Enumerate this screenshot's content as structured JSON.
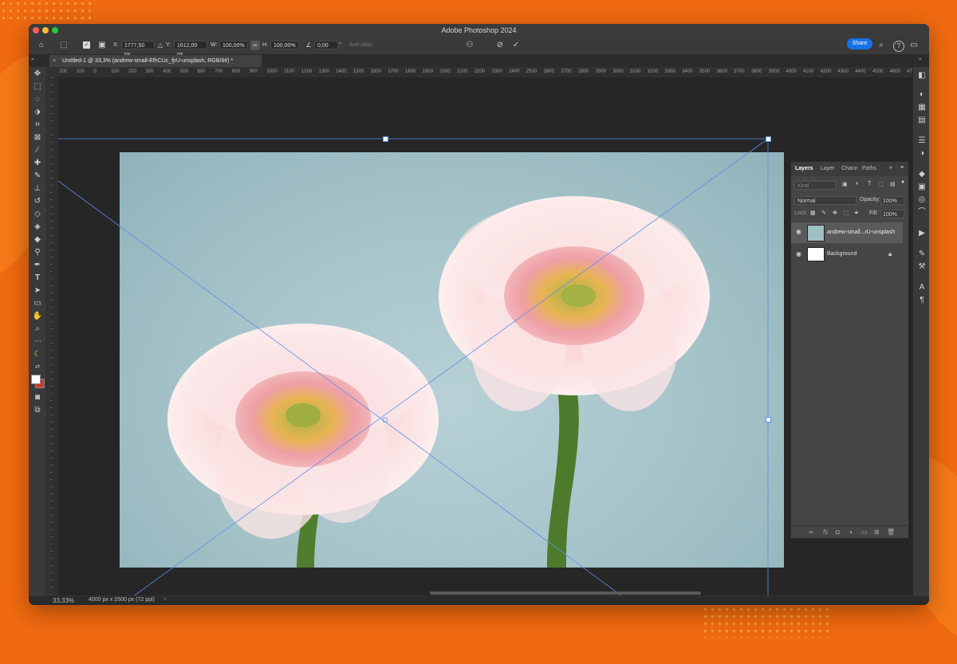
{
  "app": {
    "title": "Adobe Photoshop 2024"
  },
  "options_bar": {
    "x_label": "X:",
    "x_value": "1777,50 px",
    "y_label": "Y:",
    "y_value": "1612,00 px",
    "w_label": "W:",
    "w_value": "100,00%",
    "h_label": "H:",
    "h_value": "100,00%",
    "angle_value": "0,00",
    "angle_unit": "°",
    "antialias_label": "Anti-alias",
    "share_label": "Share"
  },
  "document_tab": {
    "close": "×",
    "label": "Untitled-1 @ 33,3% (andrew-small-EfhCUc_fjrU-unsplash, RGB/8#) *"
  },
  "ruler_top_ticks": [
    "200",
    "100",
    "0",
    "100",
    "200",
    "300",
    "400",
    "500",
    "600",
    "700",
    "800",
    "900",
    "1000",
    "1100",
    "1200",
    "1300",
    "1400",
    "1500",
    "1600",
    "1700",
    "1800",
    "1900",
    "2000",
    "2100",
    "2200",
    "2300",
    "2400",
    "2500",
    "2600",
    "2700",
    "2800",
    "2900",
    "3000",
    "3100",
    "3200",
    "3300",
    "3400",
    "3500",
    "3600",
    "3700",
    "3800",
    "3900",
    "4000",
    "4100",
    "4200",
    "4300",
    "4400",
    "4500",
    "4600",
    "4700"
  ],
  "layers_panel": {
    "tabs": [
      "Layers",
      "Layer",
      "Chann",
      "Paths"
    ],
    "filter_placeholder": "Kind",
    "blend_mode": "Normal",
    "opacity_label": "Opacity:",
    "opacity_value": "100%",
    "lock_label": "Lock:",
    "fill_label": "Fill:",
    "fill_value": "100%",
    "layers": [
      {
        "name": "andrew-small...rU-unsplash",
        "selected": true
      },
      {
        "name": "Background",
        "selected": false,
        "locked": true
      }
    ]
  },
  "status": {
    "zoom": "33,33%",
    "doc_info": "4000 px x 2500 px (72 ppi)",
    "arrow": "›"
  },
  "colors": {
    "accent": "#1473e6",
    "background": "#f06a10",
    "transform_line": "#5b8fe8"
  }
}
